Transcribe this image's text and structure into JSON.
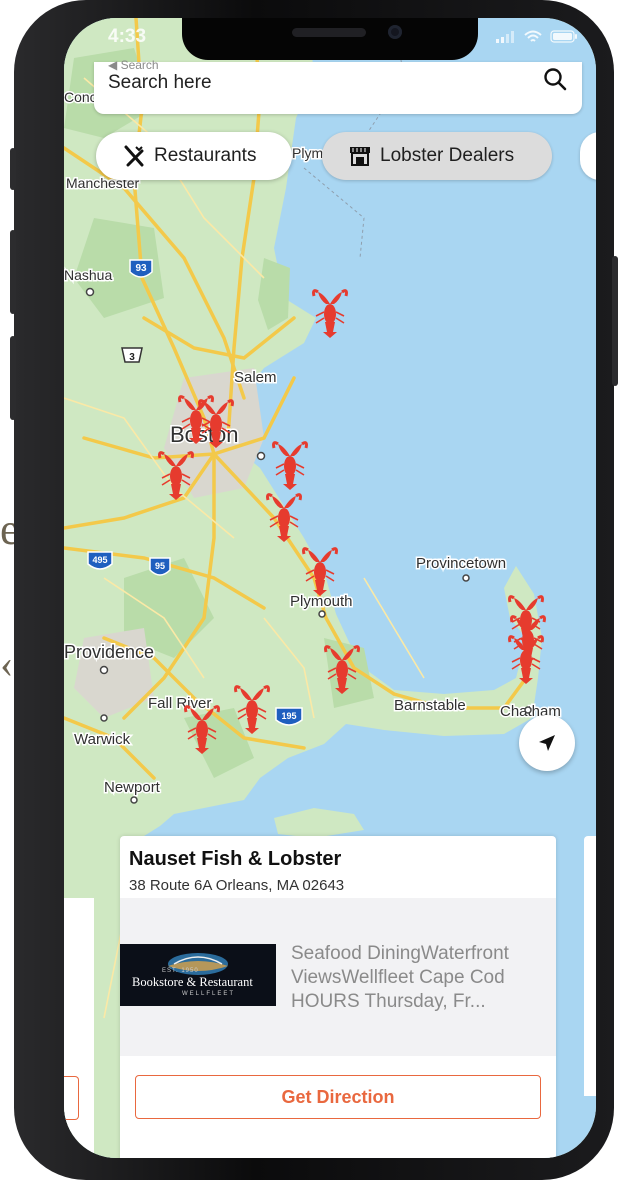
{
  "status_bar": {
    "time": "4:33"
  },
  "search": {
    "back_label": "◀ Search",
    "placeholder": "Search here"
  },
  "filters": [
    {
      "label": "Restaurants",
      "icon": "fork-knife-icon"
    },
    {
      "label": "Lobster Dealers",
      "icon": "market-stall-icon"
    }
  ],
  "map": {
    "places": [
      "Concord",
      "Manchester",
      "Nashua",
      "Plymouth",
      "Salem",
      "Boston",
      "Provincetown",
      "Providence",
      "Fall River",
      "Barnstable",
      "Chatham",
      "Warwick",
      "Newport"
    ],
    "place_partial": {
      "Concord": "Conco",
      "Plymouth_top": "Plymou"
    },
    "route_shields": [
      "93",
      "3",
      "495",
      "95",
      "195"
    ],
    "marker_icon": "lobster-marker-icon",
    "colors": {
      "water": "#a9d6f2",
      "land": "#cfe8c2",
      "road": "#f3c94a",
      "marker": "#e63b2e"
    }
  },
  "card": {
    "name": "Nauset Fish & Lobster",
    "address": "38 Route 6A Orleans, MA 02643",
    "logo_text": "Bookstore & Restaurant",
    "logo_subtext": "WELLFLEET",
    "logo_est": "EST. 1950",
    "description": "Seafood DiningWaterfront ViewsWellfleet Cape Cod HOURS Thursday, Fr...",
    "direction_label": "Get Direction",
    "accent_color": "#e9683f"
  }
}
